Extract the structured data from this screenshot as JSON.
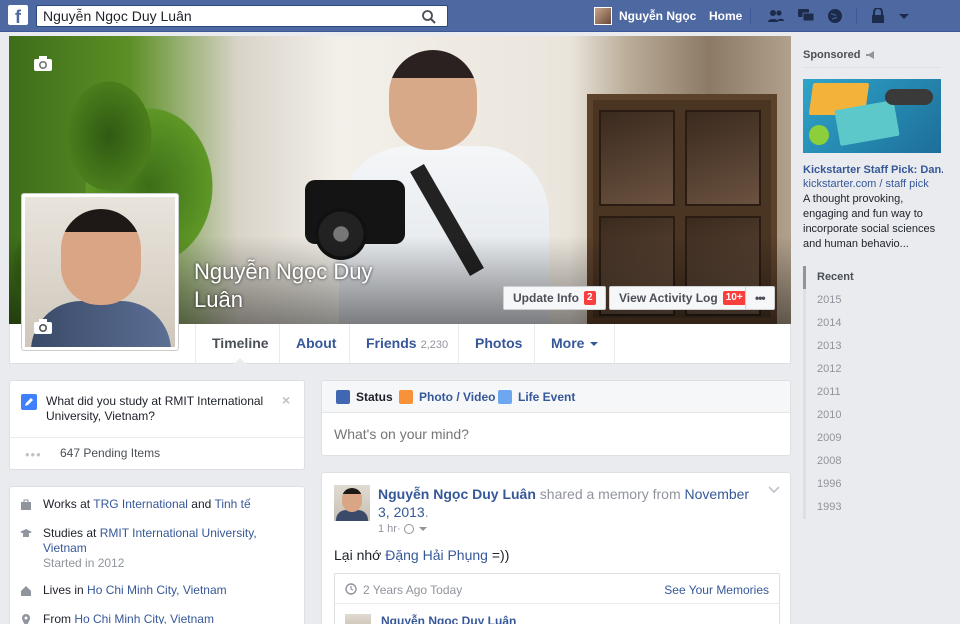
{
  "topbar": {
    "logo": "f",
    "search_value": "Nguyễn Ngọc Duy Luân",
    "user_name": "Nguyễn Ngọc",
    "home_label": "Home"
  },
  "profile": {
    "name": "Nguyễn Ngọc Duy Luân",
    "update_info_label": "Update Info",
    "update_info_count": "2",
    "activity_log_label": "View Activity Log",
    "activity_log_count": "10+",
    "more_dots": "•••"
  },
  "tabs": [
    {
      "label": "Timeline"
    },
    {
      "label": "About"
    },
    {
      "label": "Friends",
      "count": "2,230"
    },
    {
      "label": "Photos"
    },
    {
      "label": "More"
    }
  ],
  "study_prompt": {
    "text": "What did you study at RMIT International University, Vietnam?",
    "close": "×",
    "pending_dots": "•••",
    "pending_text": "647 Pending Items"
  },
  "intro": {
    "work_prefix": "Works at ",
    "work_company1": "TRG International",
    "work_and": " and ",
    "work_company2": "Tinh tế",
    "study_prefix": "Studies at ",
    "study_school": "RMIT International University, Vietnam",
    "study_started": "Started in 2012",
    "lives_prefix": "Lives in ",
    "lives_city": "Ho Chi Minh City, Vietnam",
    "from_prefix": "From ",
    "from_city": "Ho Chi Minh City, Vietnam"
  },
  "composer": {
    "status_label": "Status",
    "photo_label": "Photo / Video",
    "life_label": "Life Event",
    "placeholder": "What's on your mind?"
  },
  "post": {
    "author": "Nguyễn Ngọc Duy Luân",
    "action": " shared a memory from ",
    "date": "November 3, 2013",
    "date_suffix": ".",
    "time": "1 hr",
    "dot": " · ",
    "body_prefix": "Lại nhớ ",
    "body_mention": "Đặng Hải Phụng",
    "body_suffix": " =))",
    "memory_title": "2 Years Ago Today",
    "memory_link": "See Your Memories",
    "memory_author": "Nguyễn Ngọc Duy Luân"
  },
  "sidebar": {
    "sponsored_label": "Sponsored",
    "ad_title": "Kickstarter Staff Pick: Dan...",
    "ad_domain": "kickstarter.com / staff pick",
    "ad_desc": "A thought provoking, engaging and fun way to incorporate social sciences and human behavio...",
    "years": [
      "Recent",
      "2015",
      "2014",
      "2013",
      "2012",
      "2011",
      "2010",
      "2009",
      "2008",
      "1996",
      "1993"
    ]
  },
  "colors": {
    "topbar": "#4e69a2",
    "link": "#365899",
    "badge": "#fa3e3e"
  }
}
